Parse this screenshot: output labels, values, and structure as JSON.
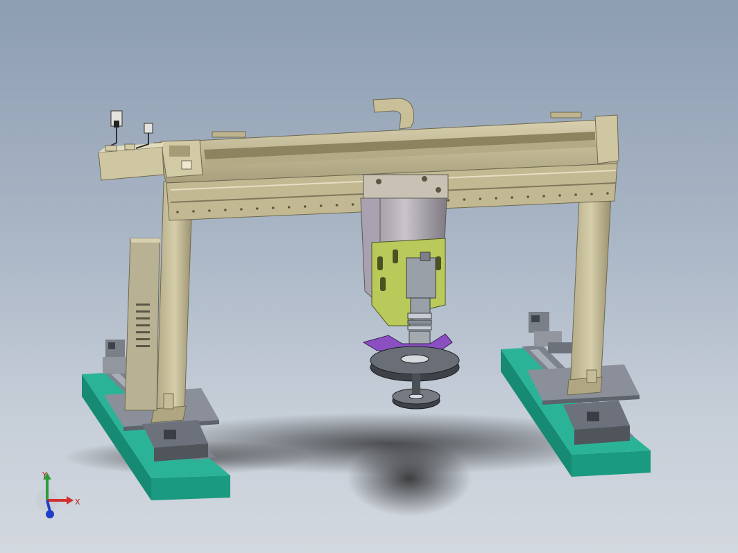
{
  "view": {
    "background": {
      "top": "#8d9db2",
      "bottom": "#d3d8df"
    },
    "model_colors": {
      "frame": "#c9c09a",
      "frame_shade": "#9c9372",
      "frame_dark": "#6e6850",
      "base_slab": "#24a88f",
      "base_slab_shade": "#168a73",
      "plate": "#8a8f9a",
      "bracket": "#b9c95a",
      "pad": "#8a4fc0",
      "disc": "#4a4e55",
      "motor": "#9aa0a8"
    }
  },
  "triad": {
    "x_label": "X",
    "y_label": "Y",
    "x_color": "#d32f2f",
    "y_color": "#2e9a3a",
    "z_color": "#1e3fc7"
  }
}
